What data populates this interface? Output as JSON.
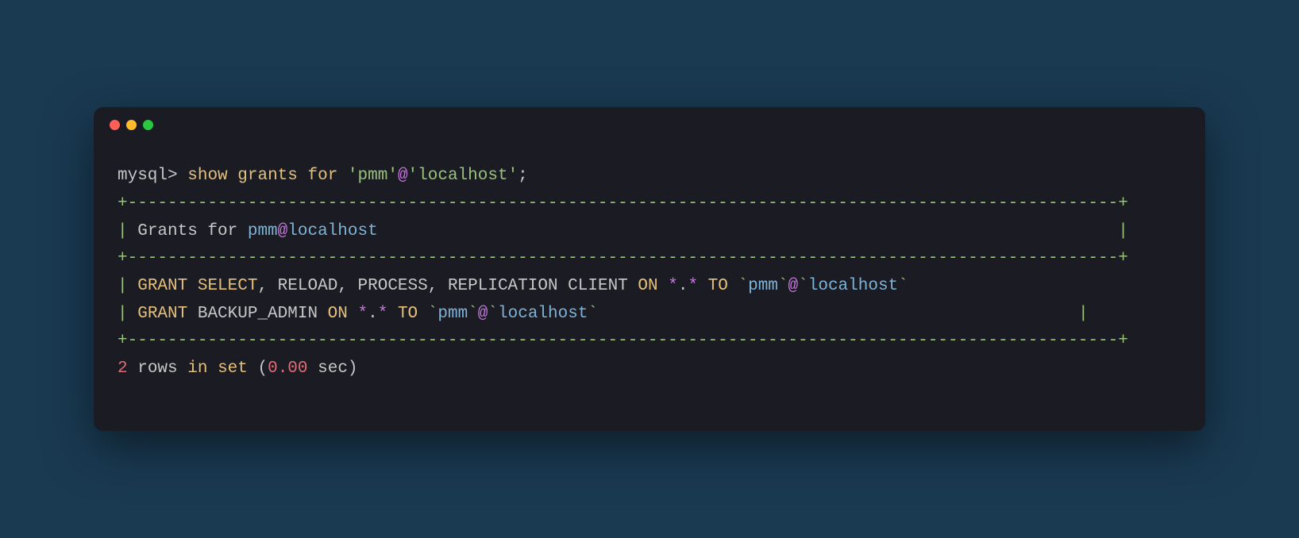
{
  "prompt": "mysql>",
  "command": {
    "show": "show",
    "grants": "grants",
    "for": "for",
    "user": "'pmm'",
    "at": "@",
    "host": "'localhost'",
    "semi": ";"
  },
  "border_top": "+---------------------------------------------------------------------------------------------------+",
  "header": {
    "pipe_l": "| ",
    "grants_for": "Grants for ",
    "user": "pmm",
    "at": "@",
    "host": "localhost",
    "padding": "                                                                          ",
    "pipe_r": "|"
  },
  "border_mid": "+---------------------------------------------------------------------------------------------------+",
  "row1": {
    "pipe_l": "| ",
    "grant": "GRANT",
    "sp1": " ",
    "select": "SELECT",
    "c1": ",",
    "sp2": " RELOAD",
    "c2": ",",
    "sp3": " PROCESS",
    "c3": ",",
    "sp4": " REPLICATION CLIENT ",
    "on": "ON",
    "sp5": " ",
    "star1": "*",
    "dot": ".",
    "star2": "*",
    "sp6": " ",
    "to": "TO",
    "sp7": " ",
    "bt1": "`",
    "user": "pmm",
    "bt2": "`",
    "at": "@",
    "bt3": "`",
    "host": "localhost",
    "bt4": "`"
  },
  "row2": {
    "pipe_l": "| ",
    "grant": "GRANT",
    "sp1": " BACKUP_ADMIN ",
    "on": "ON",
    "sp2": " ",
    "star1": "*",
    "dot": ".",
    "star2": "*",
    "sp3": " ",
    "to": "TO",
    "sp4": " ",
    "bt1": "`",
    "user": "pmm",
    "bt2": "`",
    "at": "@",
    "bt3": "`",
    "host": "localhost",
    "bt4": "`",
    "padding": "                                                ",
    "pipe_r": "|"
  },
  "border_bot": "+---------------------------------------------------------------------------------------------------+",
  "footer": {
    "num_rows": "2",
    "rows_text": " rows ",
    "in": "in",
    "sp1": " ",
    "set": "set",
    "sp2": " (",
    "time": "0.00",
    "sec": " sec)"
  }
}
